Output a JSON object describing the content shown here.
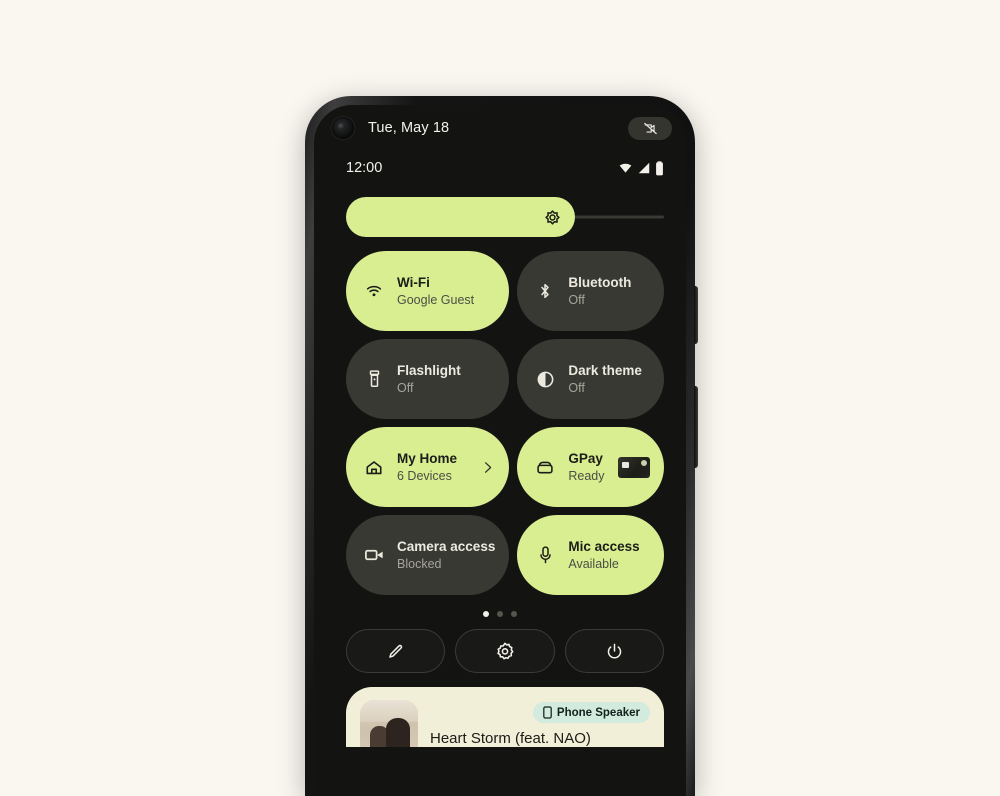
{
  "wallpaper": {
    "background_color": "#faf7f0"
  },
  "phone": {
    "screen_background": "#131412",
    "accent_color": "#d9ed91",
    "tile_off_color": "#393933"
  },
  "status_bar": {
    "date": "Tue, May 18",
    "clock": "12:00",
    "camera_blocked_icon": "camera-off-icon",
    "icons": [
      "wifi-icon",
      "signal-icon",
      "battery-icon"
    ]
  },
  "brightness": {
    "icon": "brightness-sun-icon",
    "level_percent": 72
  },
  "tiles": [
    {
      "label": "Wi-Fi",
      "sub": "Google Guest",
      "state": "on",
      "icon": "wifi-icon"
    },
    {
      "label": "Bluetooth",
      "sub": "Off",
      "state": "off",
      "icon": "bluetooth-icon"
    },
    {
      "label": "Flashlight",
      "sub": "Off",
      "state": "off",
      "icon": "flashlight-icon"
    },
    {
      "label": "Dark theme",
      "sub": "Off",
      "state": "off",
      "icon": "dark-theme-icon"
    },
    {
      "label": "My Home",
      "sub": "6 Devices",
      "state": "on",
      "icon": "home-icon",
      "trailing": "chevron-right-icon"
    },
    {
      "label": "GPay",
      "sub": "Ready",
      "state": "on",
      "icon": "wallet-icon",
      "trailing": "credit-card-art"
    },
    {
      "label": "Camera access",
      "sub": "Blocked",
      "state": "off",
      "icon": "camera-icon"
    },
    {
      "label": "Mic access",
      "sub": "Available",
      "state": "on",
      "icon": "mic-icon"
    }
  ],
  "pager": {
    "count": 3,
    "active_index": 0
  },
  "footer_buttons": [
    {
      "name": "edit-button",
      "icon": "pencil-icon"
    },
    {
      "name": "settings-button",
      "icon": "gear-icon"
    },
    {
      "name": "power-button",
      "icon": "power-icon"
    }
  ],
  "media_player": {
    "track_title": "Heart Storm (feat. NAO)",
    "output_device": "Phone Speaker",
    "output_icon": "phone-icon",
    "card_color": "#f2efd9",
    "chip_color": "#d3eadf"
  }
}
